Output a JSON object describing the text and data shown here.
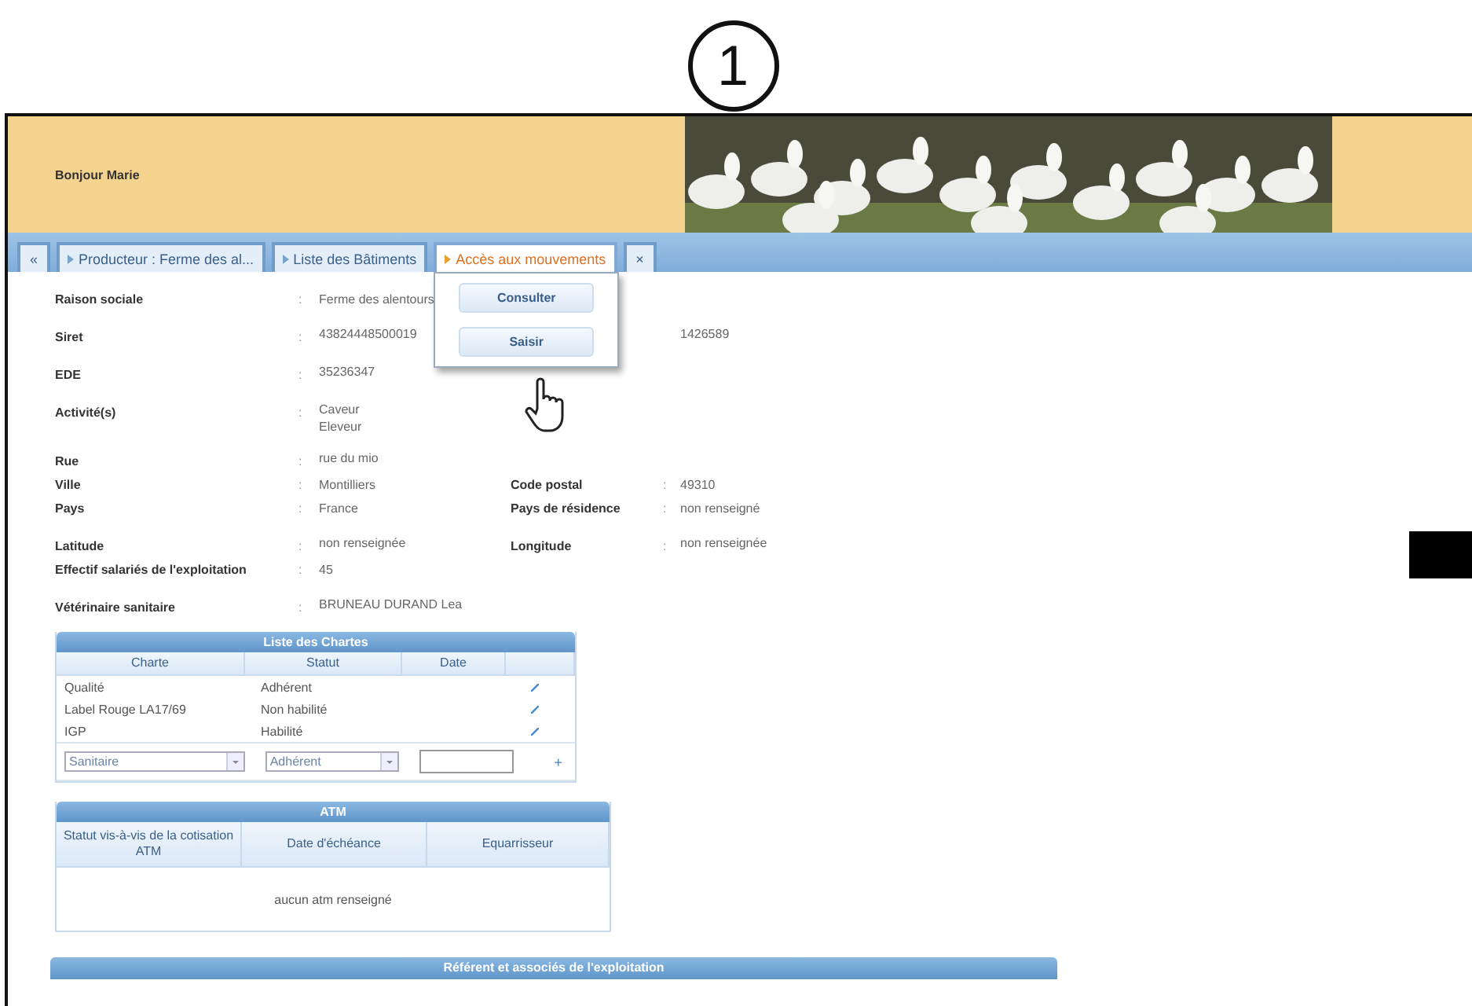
{
  "annotation": {
    "number": "1"
  },
  "header": {
    "greeting": "Bonjour Marie"
  },
  "tabs": [
    {
      "label": "«",
      "kind": "nav",
      "selected": false
    },
    {
      "label": "Producteur : Ferme des al...",
      "kind": "page",
      "selected": false
    },
    {
      "label": "Liste des Bâtiments",
      "kind": "page",
      "selected": false
    },
    {
      "label": "Accès aux mouvements",
      "kind": "page",
      "selected": true
    },
    {
      "label": "×",
      "kind": "nav",
      "selected": false
    }
  ],
  "menu": {
    "items": [
      "Consulter",
      "Saisir"
    ]
  },
  "field_groups": [
    [
      {
        "label": "Raison sociale",
        "sep": ":",
        "values": [
          "Ferme des alentours"
        ]
      }
    ],
    [
      {
        "label": "Siret",
        "sep": ":",
        "values": [
          "43824448500019"
        ],
        "right_values": [
          "1426589"
        ]
      }
    ],
    [
      {
        "label": "EDE",
        "sep": ":",
        "values": [
          "35236347"
        ]
      }
    ],
    [
      {
        "label": "Activité(s)",
        "sep": ":",
        "values": [
          "Caveur",
          "Eleveur"
        ]
      }
    ],
    [
      {
        "label": "Rue",
        "sep": ":",
        "values": [
          "rue du mio"
        ]
      },
      {
        "label": "Ville",
        "sep": ":",
        "values": [
          "Montilliers"
        ],
        "right_label": "Code postal",
        "right_sep": ":",
        "right_values": [
          "49310"
        ]
      },
      {
        "label": "Pays",
        "sep": ":",
        "values": [
          "France"
        ],
        "right_label": "Pays de résidence",
        "right_sep": ":",
        "right_values": [
          "non renseigné"
        ]
      }
    ],
    [
      {
        "label": "Latitude",
        "sep": ":",
        "values": [
          "non renseignée"
        ],
        "right_label": "Longitude",
        "right_sep": ":",
        "right_values": [
          "non renseignée"
        ]
      },
      {
        "label": "Effectif salariés de l'exploitation",
        "sep": ":",
        "values": [
          "45"
        ]
      }
    ],
    [
      {
        "label": "Vétérinaire sanitaire",
        "sep": ":",
        "values": [
          "BRUNEAU DURAND Lea"
        ]
      }
    ]
  ],
  "chartes": {
    "title": "Liste des Chartes",
    "columns": [
      "Charte",
      "Statut",
      "Date"
    ],
    "rows": [
      {
        "charte": "Qualité",
        "statut": "Adhérent"
      },
      {
        "charte": "Label Rouge LA17/69",
        "statut": "Non habilité"
      },
      {
        "charte": "IGP",
        "statut": "Habilité"
      }
    ],
    "new_row": {
      "charte": "Sanitaire",
      "statut": "Adhérent",
      "add": "+"
    }
  },
  "atm": {
    "title": "ATM",
    "columns": [
      "Statut vis-à-vis de la cotisation ATM",
      "Date d'échéance",
      "Equarrisseur"
    ],
    "empty": "aucun atm renseigné"
  },
  "section_bar": {
    "title": "Référent et associés de l'exploitation"
  }
}
